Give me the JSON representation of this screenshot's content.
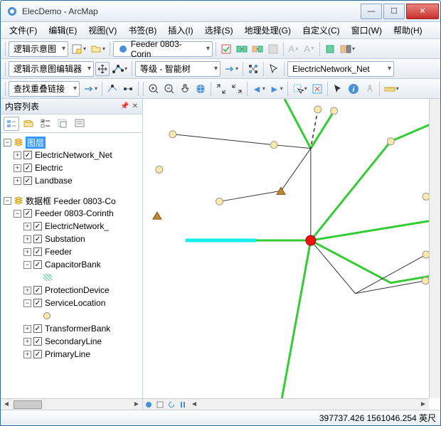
{
  "window": {
    "title": "ElecDemo - ArcMap"
  },
  "win_controls": {
    "min": "—",
    "max": "☐",
    "close": "✕"
  },
  "menu": {
    "file": "文件(F)",
    "edit": "编辑(E)",
    "view": "视图(V)",
    "bookmark": "书签(B)",
    "insert": "插入(I)",
    "select": "选择(S)",
    "geoproc": "地理处理(G)",
    "custom": "自定义(C)",
    "window": "窗口(W)",
    "help": "帮助(H)"
  },
  "toolbar1": {
    "schematic_menu": "逻辑示意图",
    "feeder_select": "Feeder 0803-Corin"
  },
  "toolbar2": {
    "editor_menu": "逻辑示意图编辑器",
    "level_select": "等级 - 智能树",
    "network_select": "ElectricNetwork_Net"
  },
  "toolbar3": {
    "find_links": "查找重叠链接"
  },
  "toc": {
    "title": "内容列表",
    "root_layers": "图层",
    "items1": [
      "ElectricNetwork_Net",
      "Electric",
      "Landbase"
    ],
    "dataframe": "数据框 Feeder 0803-Co",
    "feeder_root": "Feeder 0803-Corinth",
    "layers2": [
      "ElectricNetwork_",
      "Substation",
      "Feeder",
      "CapacitorBank",
      "ProtectionDevice",
      "ServiceLocation",
      "TransformerBank",
      "SecondaryLine",
      "PrimaryLine"
    ]
  },
  "status": {
    "coords": "397737.426  1561046.254 英尺"
  }
}
